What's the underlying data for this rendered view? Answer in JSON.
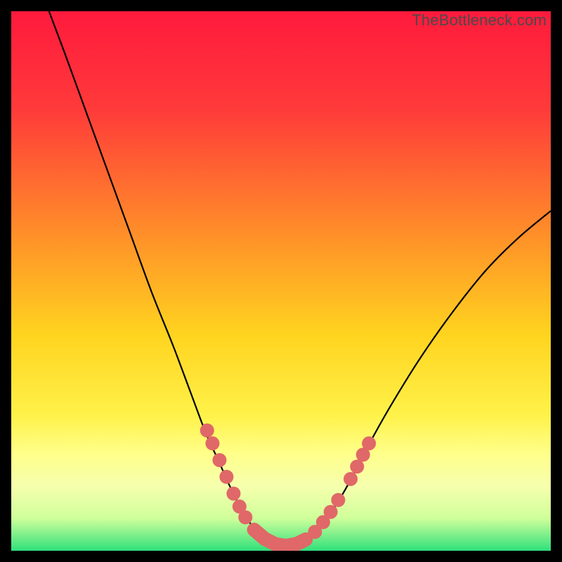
{
  "watermark": "TheBottleneck.com",
  "chart_data": {
    "type": "line",
    "title": "",
    "xlabel": "",
    "ylabel": "",
    "xlim": [
      0,
      100
    ],
    "ylim": [
      0,
      100
    ],
    "gradient_stops": [
      {
        "offset": 0,
        "color": "#ff1a3d"
      },
      {
        "offset": 18,
        "color": "#ff3a3a"
      },
      {
        "offset": 40,
        "color": "#ff8a2a"
      },
      {
        "offset": 60,
        "color": "#ffd41f"
      },
      {
        "offset": 75,
        "color": "#fff24a"
      },
      {
        "offset": 82,
        "color": "#ffff8a"
      },
      {
        "offset": 88,
        "color": "#f6ffad"
      },
      {
        "offset": 94,
        "color": "#cfff9a"
      },
      {
        "offset": 100,
        "color": "#2fe07b"
      }
    ],
    "curve": [
      {
        "x": 7.0,
        "y": 100.0
      },
      {
        "x": 10.0,
        "y": 92.0
      },
      {
        "x": 14.0,
        "y": 81.0
      },
      {
        "x": 18.0,
        "y": 70.0
      },
      {
        "x": 22.0,
        "y": 59.0
      },
      {
        "x": 26.0,
        "y": 48.0
      },
      {
        "x": 30.0,
        "y": 38.0
      },
      {
        "x": 33.0,
        "y": 30.0
      },
      {
        "x": 36.0,
        "y": 22.0
      },
      {
        "x": 38.5,
        "y": 16.5
      },
      {
        "x": 40.5,
        "y": 12.0
      },
      {
        "x": 42.5,
        "y": 8.0
      },
      {
        "x": 44.5,
        "y": 4.8
      },
      {
        "x": 46.5,
        "y": 2.6
      },
      {
        "x": 48.5,
        "y": 1.3
      },
      {
        "x": 50.5,
        "y": 0.8
      },
      {
        "x": 52.5,
        "y": 1.0
      },
      {
        "x": 54.0,
        "y": 1.8
      },
      {
        "x": 56.0,
        "y": 3.3
      },
      {
        "x": 58.0,
        "y": 5.5
      },
      {
        "x": 60.0,
        "y": 8.2
      },
      {
        "x": 62.0,
        "y": 11.5
      },
      {
        "x": 64.0,
        "y": 15.2
      },
      {
        "x": 67.0,
        "y": 21.0
      },
      {
        "x": 71.0,
        "y": 28.0
      },
      {
        "x": 76.0,
        "y": 36.0
      },
      {
        "x": 82.0,
        "y": 44.5
      },
      {
        "x": 88.0,
        "y": 52.0
      },
      {
        "x": 94.0,
        "y": 58.0
      },
      {
        "x": 100.0,
        "y": 63.0
      }
    ],
    "markers": [
      {
        "x": 36.3,
        "y": 22.3,
        "shape": "round"
      },
      {
        "x": 37.3,
        "y": 19.9,
        "shape": "round"
      },
      {
        "x": 38.6,
        "y": 16.8,
        "shape": "round"
      },
      {
        "x": 39.9,
        "y": 13.7,
        "shape": "round"
      },
      {
        "x": 41.2,
        "y": 10.6,
        "shape": "round"
      },
      {
        "x": 42.3,
        "y": 8.2,
        "shape": "round"
      },
      {
        "x": 43.4,
        "y": 6.2,
        "shape": "round"
      },
      {
        "x": 45.0,
        "y": 3.9,
        "shape": "pill_start"
      },
      {
        "x": 47.0,
        "y": 2.2,
        "shape": "pill_mid"
      },
      {
        "x": 49.0,
        "y": 1.2,
        "shape": "pill_mid"
      },
      {
        "x": 51.0,
        "y": 0.9,
        "shape": "pill_mid"
      },
      {
        "x": 53.0,
        "y": 1.3,
        "shape": "pill_mid"
      },
      {
        "x": 54.6,
        "y": 2.1,
        "shape": "pill_end"
      },
      {
        "x": 56.3,
        "y": 3.5,
        "shape": "round"
      },
      {
        "x": 57.8,
        "y": 5.3,
        "shape": "round"
      },
      {
        "x": 59.2,
        "y": 7.2,
        "shape": "round"
      },
      {
        "x": 60.6,
        "y": 9.4,
        "shape": "round"
      },
      {
        "x": 62.9,
        "y": 13.3,
        "shape": "round"
      },
      {
        "x": 64.1,
        "y": 15.6,
        "shape": "round"
      },
      {
        "x": 65.2,
        "y": 17.8,
        "shape": "round"
      },
      {
        "x": 66.3,
        "y": 19.9,
        "shape": "round"
      }
    ],
    "marker_color": "#e06868",
    "marker_radius": 10
  }
}
